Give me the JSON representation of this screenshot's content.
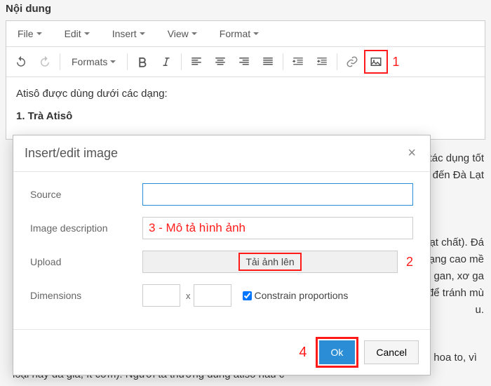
{
  "fieldTitle": "Nội dung",
  "menubar": [
    "File",
    "Edit",
    "Insert",
    "View",
    "Format"
  ],
  "toolbar": {
    "formats": "Formats"
  },
  "annotations": {
    "n1": "1",
    "n2": "2",
    "n3": "3 - Mô tả hình ảnh",
    "n4": "4"
  },
  "content": {
    "intro": "Atisô được dùng dưới các dạng:",
    "h1": "1. Trà Atisô"
  },
  "bgRight": {
    "l1": "ó tác dụng tốt",
    "l2": "hi đến Đà Lạt",
    "l3": "hoạt chất). Đá",
    "l4": " dạng cao mề",
    "l5": "áng gan, xơ ga",
    "l6": "y để tránh mù",
    "l7": "u."
  },
  "bgBottom": "Hoa atisô là một loại rau cao cấp. Nên chọn những bông atisô mập, chưa nở (k phải chọn hoa to, vì loại này đã già, ít cơm). Người ta thường dùng atisô nấu c",
  "dialog": {
    "title": "Insert/edit image",
    "source": "Source",
    "desc": "Image description",
    "upload": "Upload",
    "uploadBtn": "Tải ảnh lên",
    "dims": "Dimensions",
    "x": "x",
    "constrain": "Constrain proportions",
    "ok": "Ok",
    "cancel": "Cancel"
  }
}
